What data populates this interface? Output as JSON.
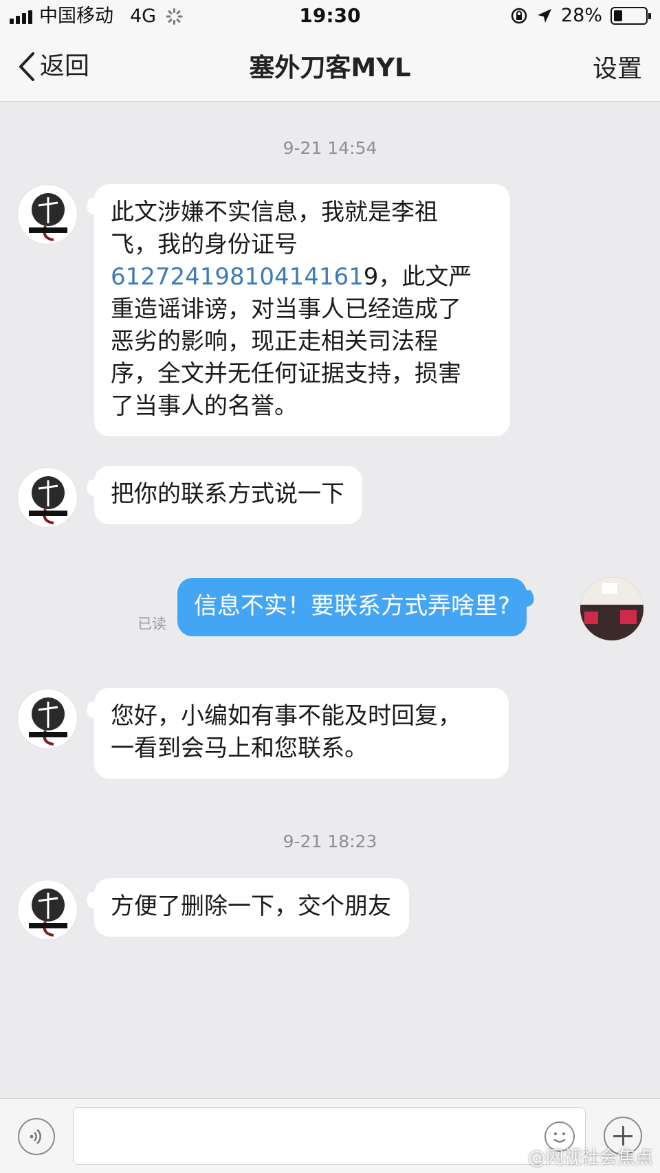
{
  "status_bar": {
    "carrier": "中国移动",
    "network": "4G",
    "time": "19:30",
    "battery_text": "28%",
    "battery_level": 0.28
  },
  "nav": {
    "back_label": "返回",
    "title": "塞外刀客MYL",
    "settings_label": "设置"
  },
  "chat": {
    "timestamps": [
      "9-21 14:54",
      "9-21 18:23"
    ],
    "messages": [
      {
        "sender": "other",
        "lines": [
          "此文涉嫌不实信息，我就是李祖",
          "飞，我的身份证号",
          "",
          "重造谣诽谤，对当事人已经造成了",
          "恶劣的影响，现正走相关司法程",
          "序，全文并无任何证据支持，损害",
          "了当事人的名誉。"
        ],
        "id_link": "61272419810414161",
        "id_tail": "9，此文严"
      },
      {
        "sender": "other",
        "text": "把你的联系方式说一下"
      },
      {
        "sender": "me",
        "text": "信息不实！要联系方式弄啥里?",
        "status": "已读"
      },
      {
        "sender": "other",
        "lines": [
          "您好，小编如有事不能及时回复，",
          "一看到会马上和您联系。"
        ]
      },
      {
        "sender": "other",
        "text": "方便了删除一下，交个朋友"
      }
    ]
  },
  "input_bar": {
    "placeholder": ""
  },
  "watermark": "@网视社会焦点",
  "colors": {
    "background": "#ebebed",
    "my_bubble": "#45a5f5",
    "link": "#3b7bb8"
  },
  "icons": [
    "chevron-left-icon",
    "voice-icon",
    "emoji-icon",
    "plus-icon",
    "location-arrow-icon",
    "rotation-lock-icon",
    "weibo-icon"
  ]
}
